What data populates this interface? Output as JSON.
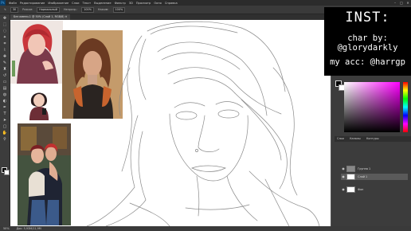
{
  "menubar": {
    "logo": "Ps",
    "items": [
      "Файл",
      "Редактирование",
      "Изображение",
      "Слои",
      "Текст",
      "Выделение",
      "Фильтр",
      "3D",
      "Просмотр",
      "Окно",
      "Справка"
    ],
    "window_controls": [
      "–",
      "□",
      "✕"
    ]
  },
  "optbar": {
    "tool_icon": "brush-icon",
    "size": "30",
    "mode_label": "Режим:",
    "mode": "Нормальный",
    "opacity_label": "Непрозр.:",
    "opacity": "100%",
    "flow_label": "Нажим:",
    "flow": "100%"
  },
  "tab": {
    "label": "Без имени-1 @ 50% (Слой 1, RGB/8) ✕"
  },
  "overlay": {
    "line1": "INST:",
    "line2": "char by: @glorydarkly",
    "line3": "my acc: @harrgp"
  },
  "panel_tabs": [
    "Слои",
    "Каналы",
    "Контуры"
  ],
  "layers": [
    {
      "name": "Группа 1"
    },
    {
      "name": "Слой 1"
    },
    {
      "name": "Фон"
    }
  ],
  "statusbar": {
    "zoom": "50%",
    "doc": "Док: 5,93M/11,9M"
  },
  "colors": {
    "ui_dark": "#2b2b2b",
    "ui_panel": "#3c3c3c",
    "canvas": "#ffffff",
    "accent": "#ff00ff"
  }
}
